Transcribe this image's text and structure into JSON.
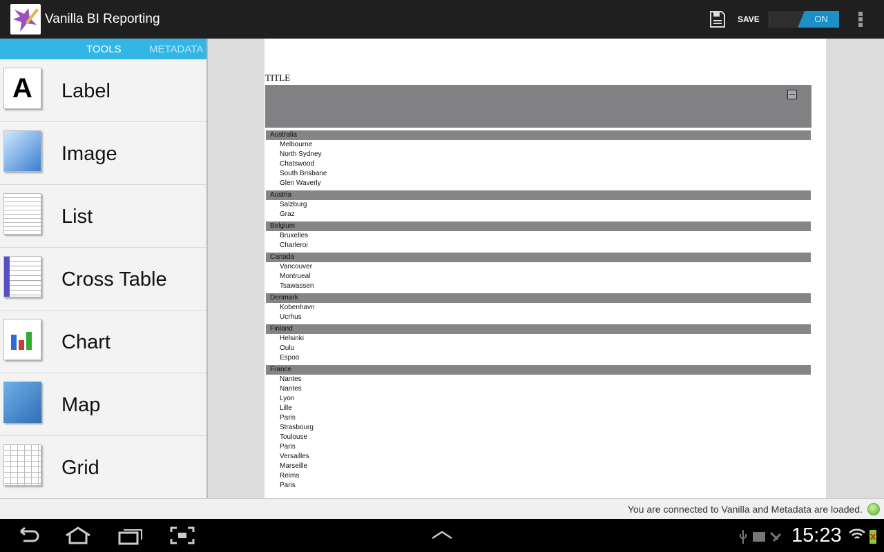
{
  "app": {
    "title": "Vanilla BI Reporting",
    "save_label": "SAVE",
    "toggle_label": "ON"
  },
  "sidebar": {
    "tabs": [
      {
        "label": "TOOLS"
      },
      {
        "label": "METADATA"
      }
    ],
    "items": [
      {
        "label": "Label",
        "icon": "label-icon"
      },
      {
        "label": "Image",
        "icon": "image-icon"
      },
      {
        "label": "List",
        "icon": "list-icon"
      },
      {
        "label": "Cross Table",
        "icon": "cross-table-icon"
      },
      {
        "label": "Chart",
        "icon": "chart-icon"
      },
      {
        "label": "Map",
        "icon": "map-icon"
      },
      {
        "label": "Grid",
        "icon": "grid-icon"
      }
    ]
  },
  "report": {
    "title": "TITLE",
    "groups": [
      {
        "name": "Australia",
        "cities": [
          "Melbourne",
          "North Sydney",
          "Chatswood",
          "South Brisbane",
          "Glen Waverly"
        ]
      },
      {
        "name": "Austria",
        "cities": [
          "Salzburg",
          "Graz"
        ]
      },
      {
        "name": "Belgium",
        "cities": [
          "Bruxelles",
          "Charleroi"
        ]
      },
      {
        "name": "Canada",
        "cities": [
          "Vancouver",
          "Montrueal",
          "Tsawassen"
        ]
      },
      {
        "name": "Denmark",
        "cities": [
          "Kobenhavn",
          "Ucrhus"
        ]
      },
      {
        "name": "Finland",
        "cities": [
          "Helsinki",
          "Oulu",
          "Espoo"
        ]
      },
      {
        "name": "France",
        "cities": [
          "Nantes",
          "Nantes",
          "Lyon",
          "Lille",
          "Paris",
          "Strasbourg",
          "Toulouse",
          "Paris",
          "Versailles",
          "Marseille",
          "Reims",
          "Paris"
        ]
      }
    ]
  },
  "status": {
    "message": "You are connected to Vanilla and Metadata are loaded."
  },
  "system": {
    "clock": "15:23"
  },
  "colors": {
    "accent": "#33b5e5",
    "toggle_on": "#1c8fc4",
    "group_header": "#858585"
  }
}
